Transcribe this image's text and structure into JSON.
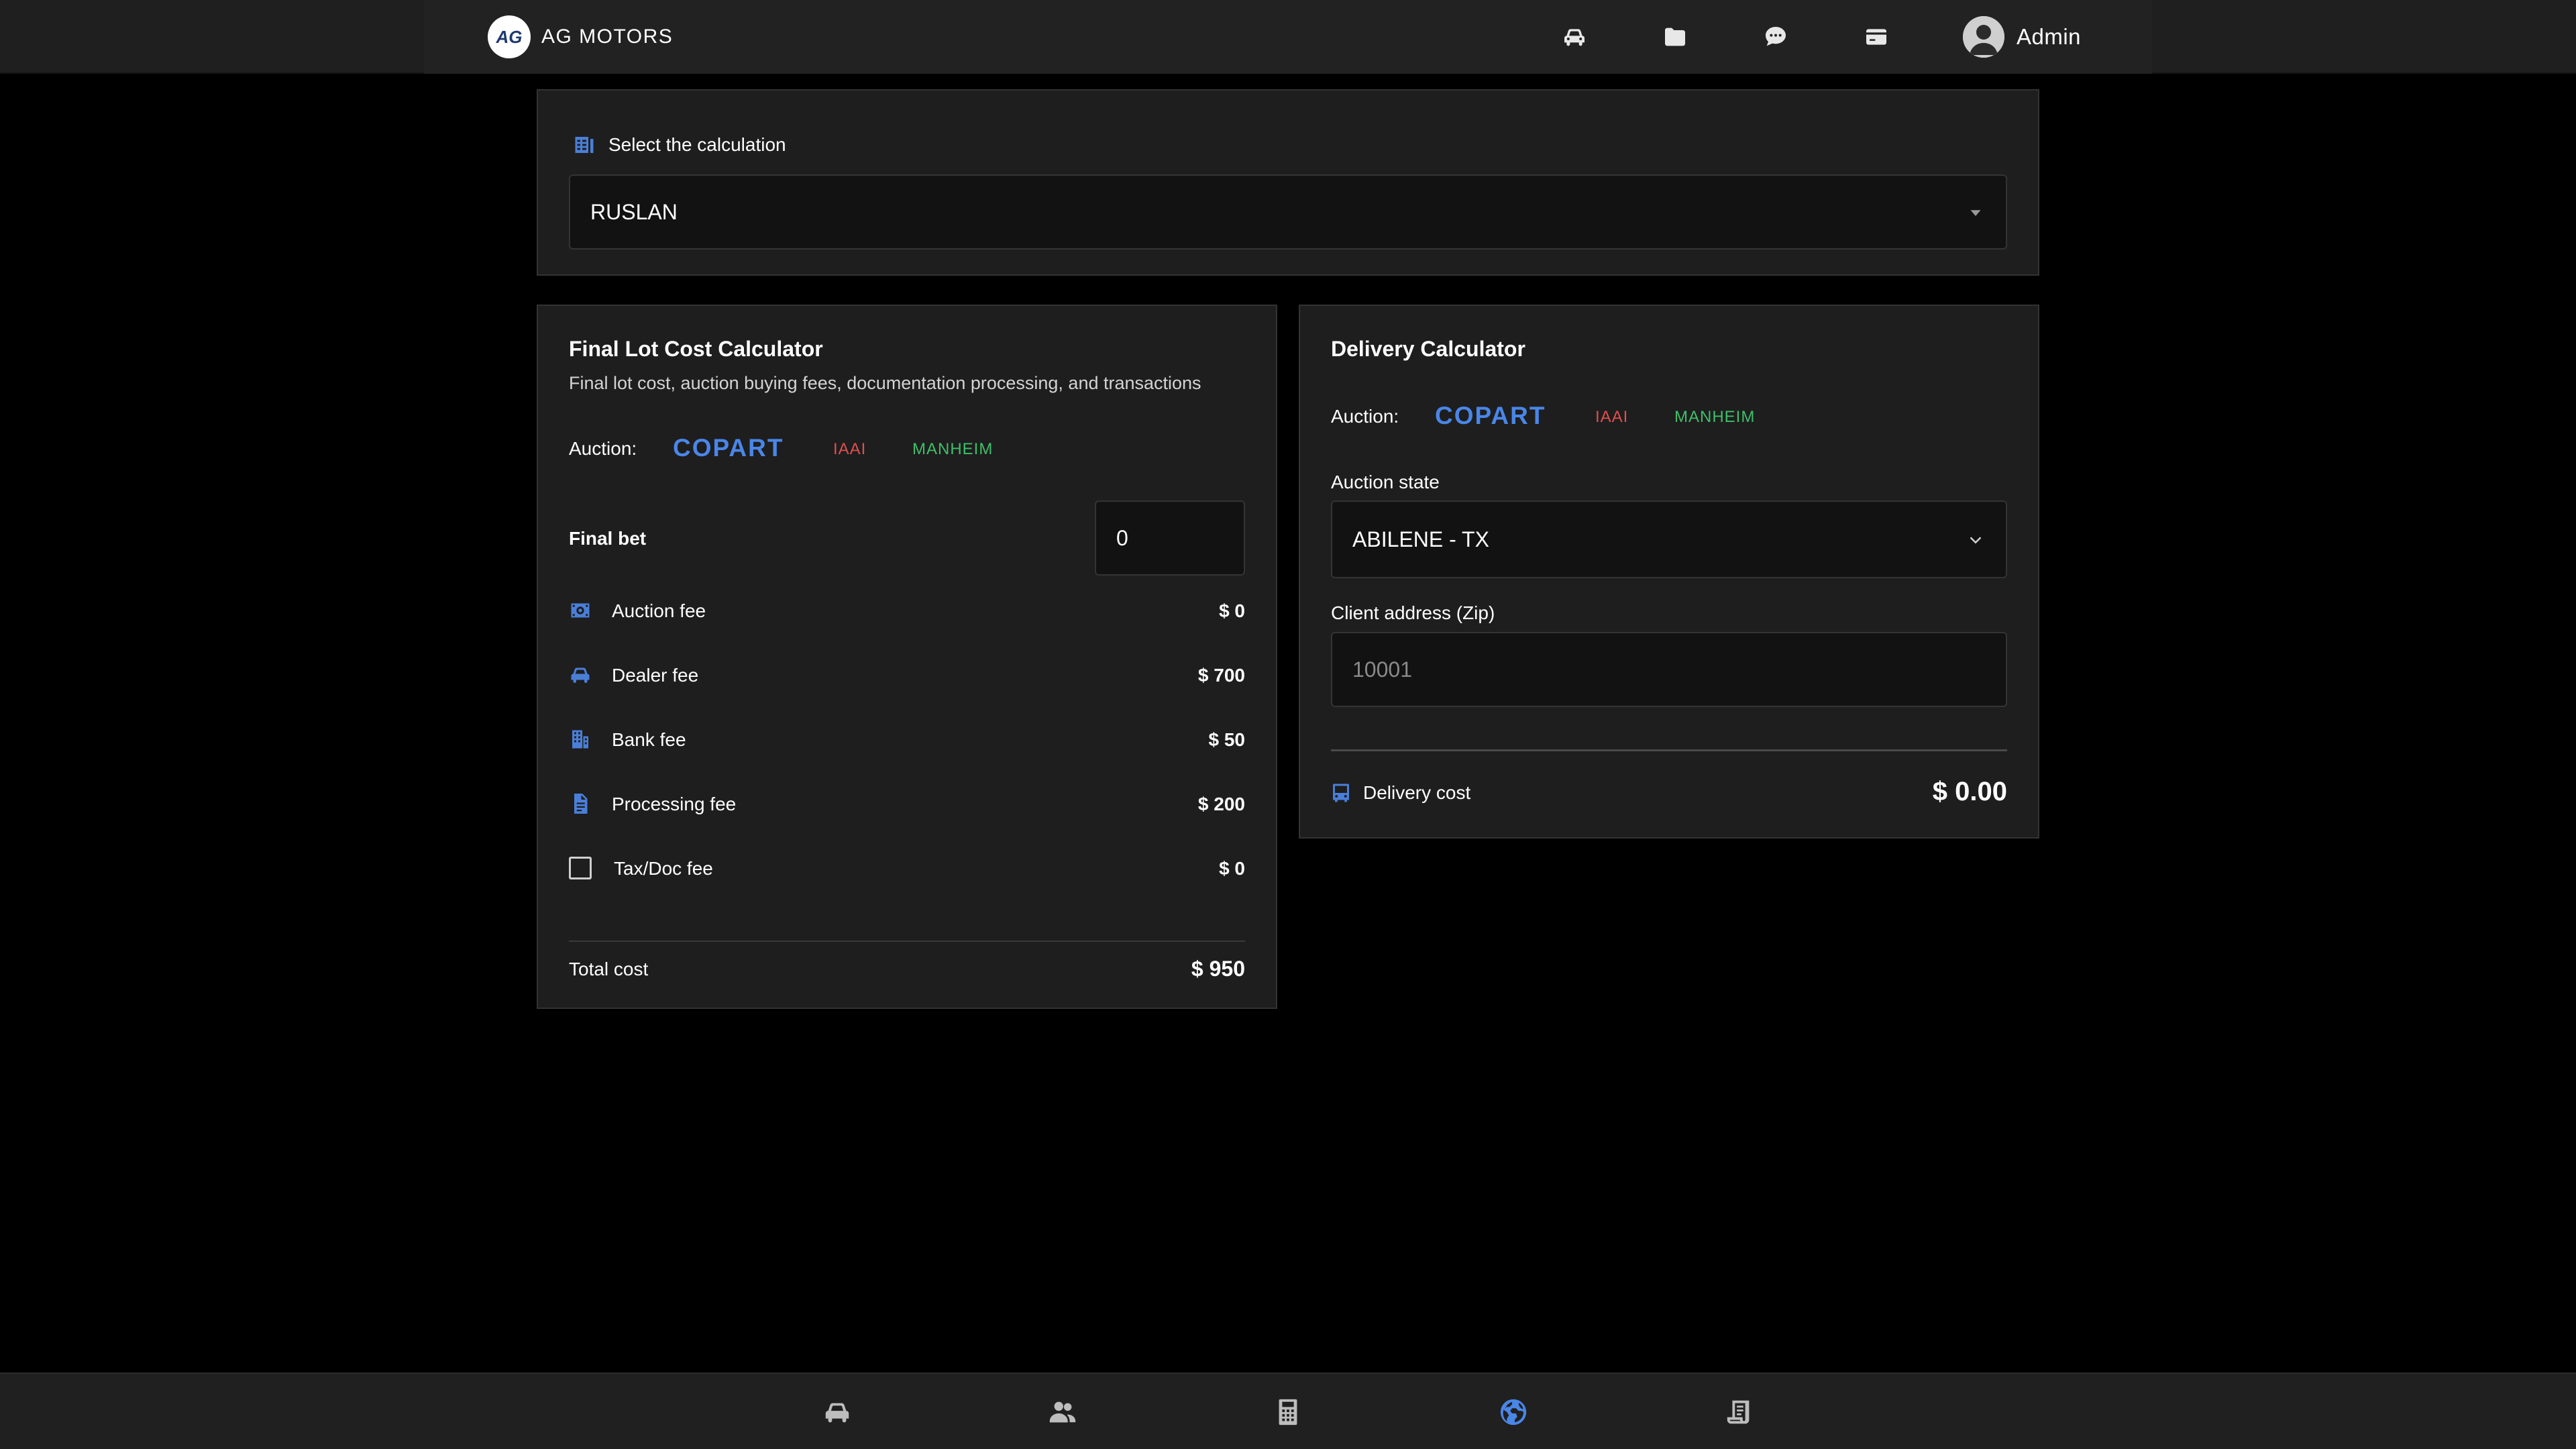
{
  "header": {
    "logo_text": "AG",
    "brand": "AG MOTORS",
    "nav_icons": [
      "car-icon",
      "folder-icon",
      "chat-icon",
      "card-icon"
    ],
    "user_label": "Admin"
  },
  "calculation_select": {
    "label": "Select the calculation",
    "value": "RUSLAN"
  },
  "lot_calculator": {
    "title": "Final Lot Cost Calculator",
    "subtitle": "Final lot cost, auction buying fees, documentation processing, and transactions",
    "auction_label": "Auction:",
    "auctions": [
      "COPART",
      "IAAI",
      "MANHEIM"
    ],
    "final_bet_label": "Final bet",
    "final_bet_value": "0",
    "fees": [
      {
        "label": "Auction fee",
        "value": "$ 0",
        "icon": "gear-icon"
      },
      {
        "label": "Dealer fee",
        "value": "$ 700",
        "icon": "car-icon"
      },
      {
        "label": "Bank fee",
        "value": "$ 50",
        "icon": "building-icon"
      },
      {
        "label": "Processing fee",
        "value": "$ 200",
        "icon": "document-icon"
      },
      {
        "label": "Tax/Doc fee",
        "value": "$ 0",
        "icon": "checkbox-icon"
      }
    ],
    "total_label": "Total cost",
    "total_value": "$ 950"
  },
  "delivery_calculator": {
    "title": "Delivery Calculator",
    "auction_label": "Auction:",
    "auctions": [
      "COPART",
      "IAAI",
      "MANHEIM"
    ],
    "state_label": "Auction state",
    "state_value": "ABILENE - TX",
    "zip_label": "Client address (Zip)",
    "zip_placeholder": "10001",
    "cost_label": "Delivery cost",
    "cost_value": "$ 0.00"
  },
  "bottom_nav": {
    "icons": [
      "car-icon",
      "users-icon",
      "calculator-icon",
      "globe-icon",
      "receipt-icon"
    ],
    "active_index": 3
  },
  "colors": {
    "accent": "#4a86e8",
    "iaai": "#e05050",
    "manheim": "#3fbf6a",
    "card_bg": "#1e1e1e",
    "page_bg": "#000000"
  }
}
